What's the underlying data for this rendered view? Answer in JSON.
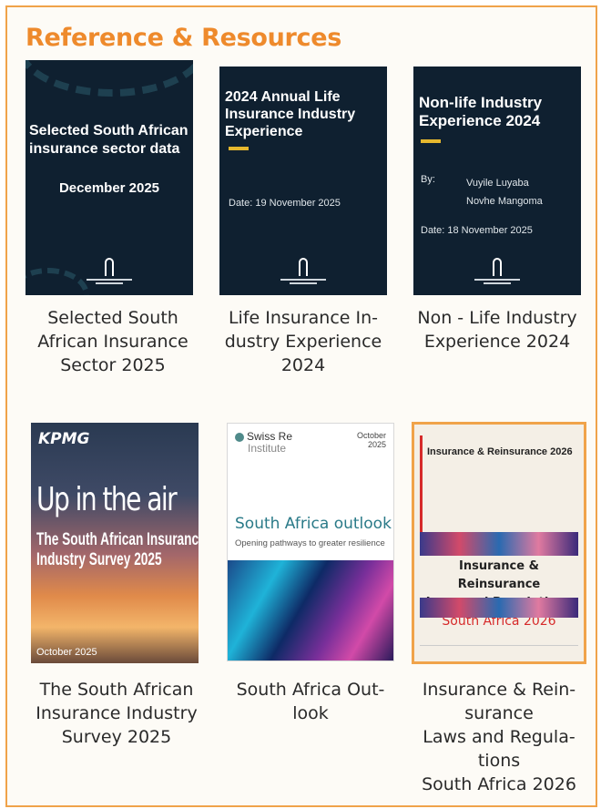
{
  "heading": "Reference & Resources",
  "resources": [
    {
      "cover_title": "Selected South African insurance sector data",
      "cover_date": "December 2025",
      "caption": "Selected South\nAfrican Insurance\nSector 2025"
    },
    {
      "cover_title": "2024 Annual Life Insurance Industry Experience",
      "cover_date": "Date: 19 November 2025",
      "caption": "Life Insurance In-\ndustry Experience\n2024"
    },
    {
      "cover_title": "Non-life Industry Experience 2024",
      "cover_by": "By:",
      "cover_authors": "Vuyile Luyaba\nNovhe Mangoma",
      "cover_date": "Date: 18 November 2025",
      "caption": "Non - Life Industry\nExperience 2024"
    },
    {
      "cover_brand": "KPMG",
      "cover_title": "Up in the air",
      "cover_subtitle": "The South African Insurance Industry Survey 2025",
      "cover_date": "October 2025",
      "caption": "The South African\nInsurance Industry\nSurvey 2025"
    },
    {
      "cover_brand": "Swiss Re",
      "cover_brand_sub": "Institute",
      "cover_date": "October\n2025",
      "cover_title": "South Africa outlook",
      "cover_subtitle": "Opening pathways to greater resilience",
      "caption": "South Africa Out-\nlook"
    },
    {
      "cover_title": "Insurance & Reinsurance 2026",
      "cover_box_line1": "Insurance & Reinsurance",
      "cover_box_line2": "Laws and Regulations",
      "cover_box_line3": "South Africa 2026",
      "caption": "Insurance & Rein-\nsurance\nLaws and Regula-\ntions\nSouth Africa 2026"
    }
  ],
  "colors": {
    "accent": "#ee8a2c",
    "border": "#f0a34a",
    "navy": "#0f2030"
  }
}
